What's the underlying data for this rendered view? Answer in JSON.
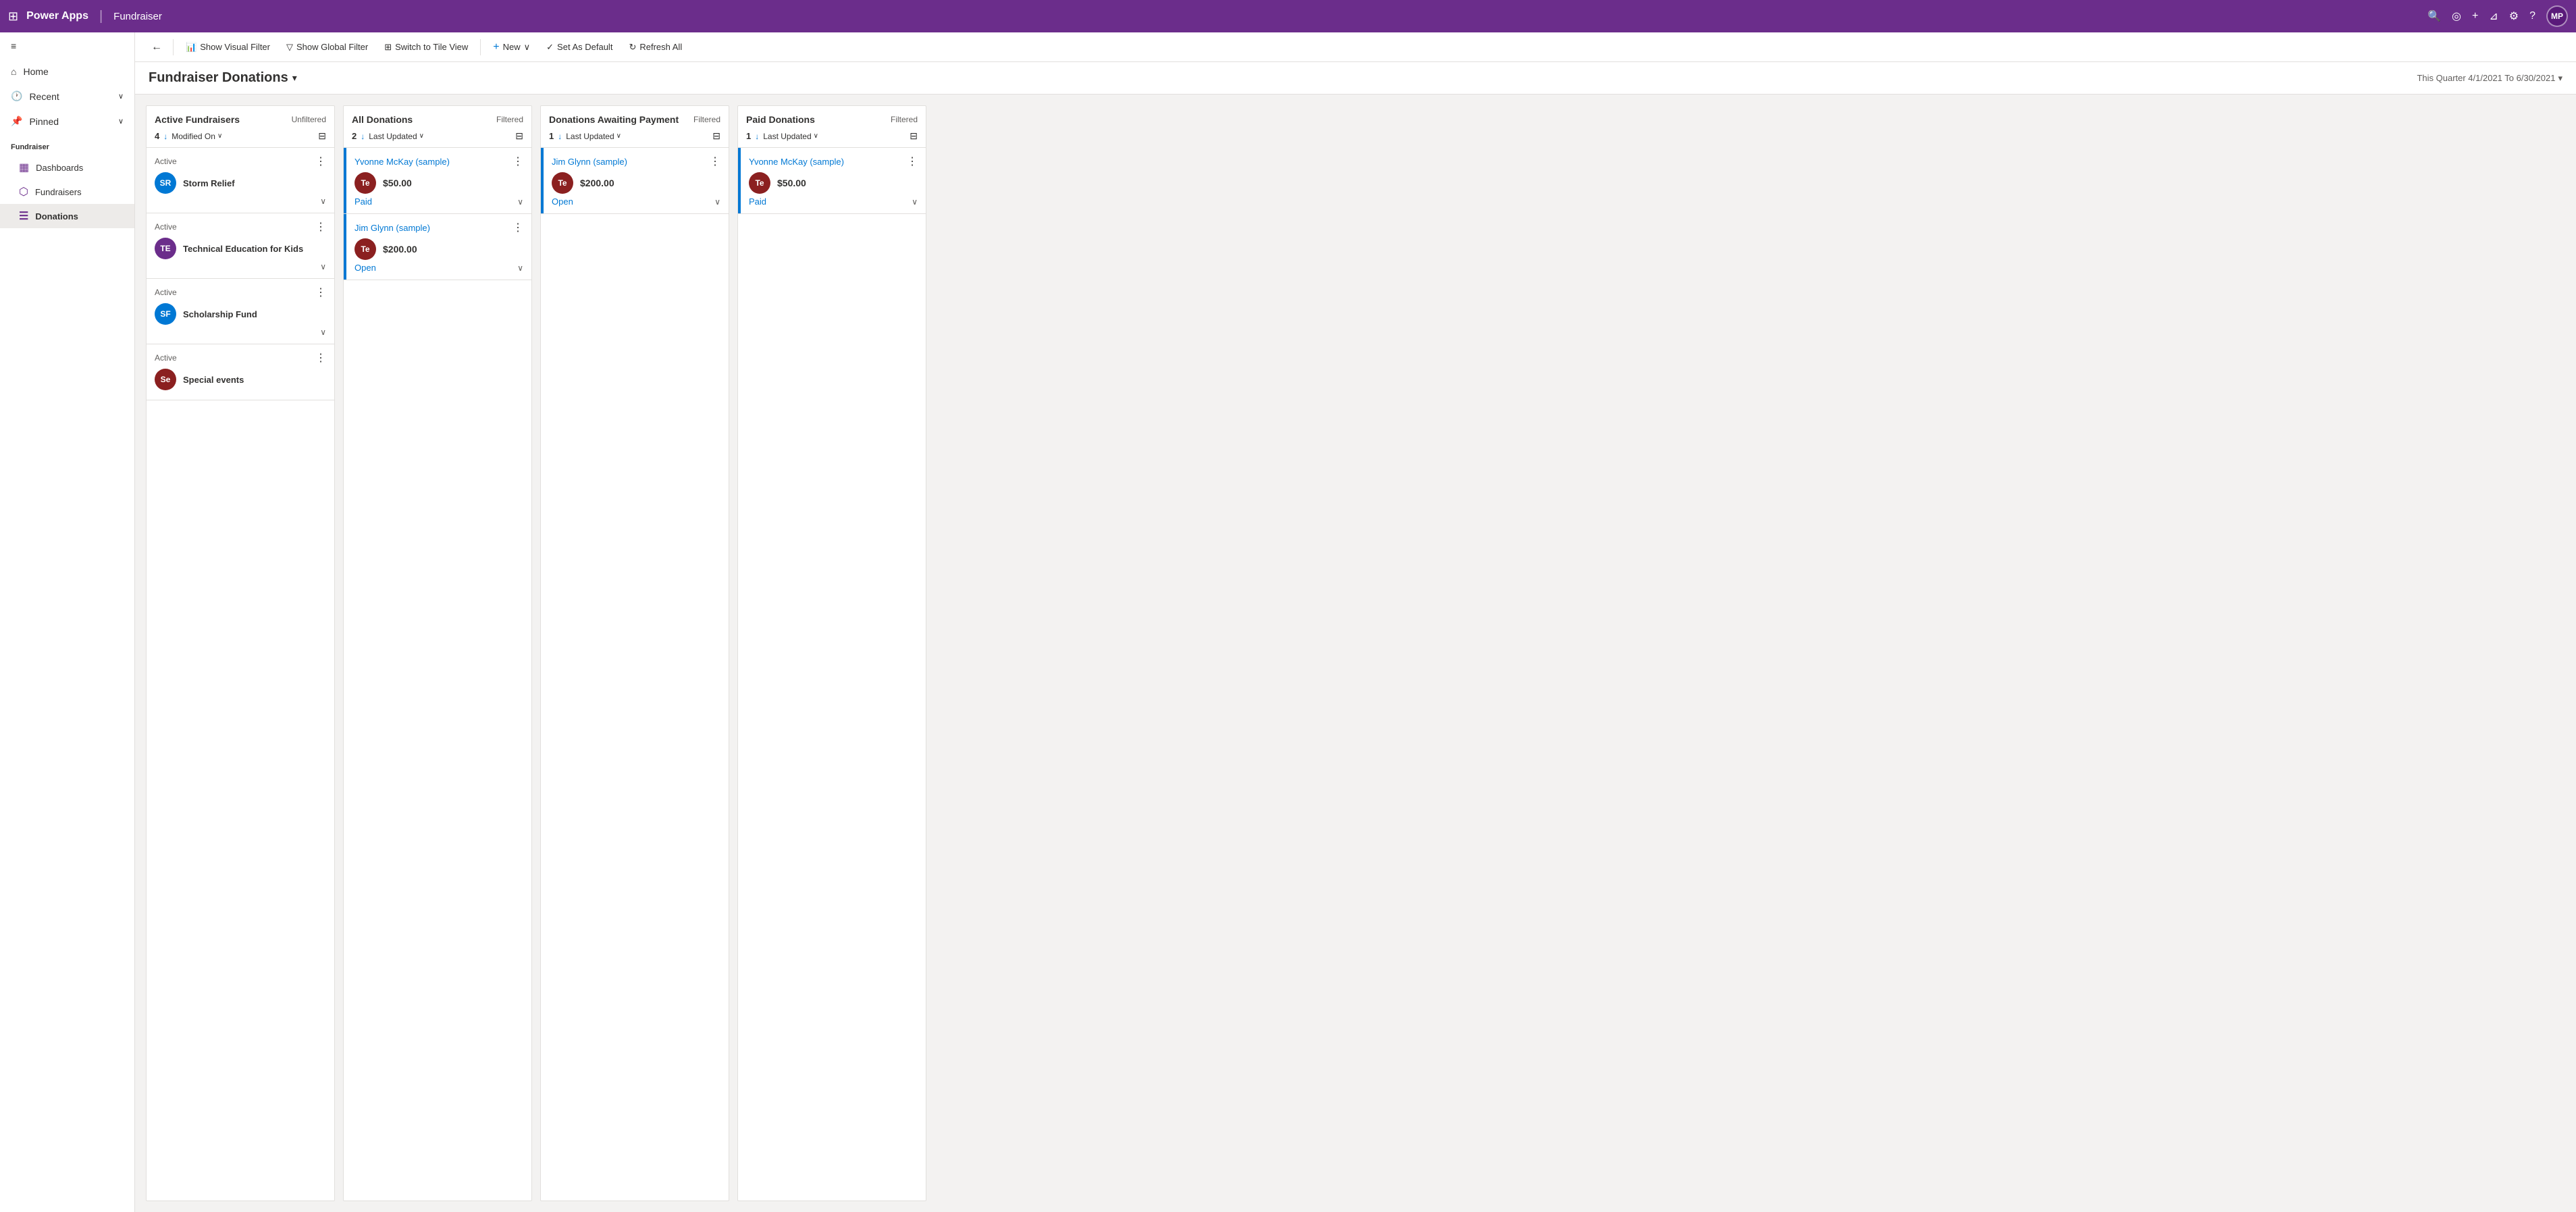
{
  "topNav": {
    "brand": "Power Apps",
    "appName": "Fundraiser",
    "separator": "|",
    "icons": [
      "search",
      "circle-checkmark",
      "plus",
      "filter",
      "settings",
      "help"
    ],
    "avatar": "MP"
  },
  "sidebar": {
    "toggle_icon": "≡",
    "nav_items": [
      {
        "label": "Home",
        "icon": "⌂"
      },
      {
        "label": "Recent",
        "icon": "🕐",
        "has_chevron": true
      },
      {
        "label": "Pinned",
        "icon": "📌",
        "has_chevron": true
      }
    ],
    "section_label": "Fundraiser",
    "sub_items": [
      {
        "label": "Dashboards",
        "icon": "▦"
      },
      {
        "label": "Fundraisers",
        "icon": "💰"
      },
      {
        "label": "Donations",
        "icon": "🗒",
        "active": true
      }
    ]
  },
  "commandBar": {
    "back_arrow": "←",
    "buttons": [
      {
        "id": "show-visual-filter",
        "icon": "📊",
        "label": "Show Visual Filter"
      },
      {
        "id": "show-global-filter",
        "icon": "▽",
        "label": "Show Global Filter"
      },
      {
        "id": "switch-tile-view",
        "icon": "⊞",
        "label": "Switch to Tile View"
      },
      {
        "id": "new",
        "icon": "+",
        "label": "New",
        "has_chevron": true
      },
      {
        "id": "set-default",
        "icon": "✓",
        "label": "Set As Default"
      },
      {
        "id": "refresh-all",
        "icon": "↻",
        "label": "Refresh All"
      }
    ]
  },
  "pageHeader": {
    "title": "Fundraiser Donations",
    "chevron": "▾",
    "dateFilter": "This Quarter 4/1/2021 To 6/30/2021",
    "dateChevron": "▾"
  },
  "kanban": {
    "columns": [
      {
        "id": "active-fundraisers",
        "title": "Active Fundraisers",
        "filterLabel": "Unfiltered",
        "count": 4,
        "sortField": "Modified On",
        "cards": [
          {
            "status": "Active",
            "name": "Storm Relief",
            "avatarBg": "#0078d4",
            "avatarText": "SR"
          },
          {
            "status": "Active",
            "name": "Technical Education for Kids",
            "avatarBg": "#6b2d8b",
            "avatarText": "TE"
          },
          {
            "status": "Active",
            "name": "Scholarship Fund",
            "avatarBg": "#0078d4",
            "avatarText": "SF"
          },
          {
            "status": "Active",
            "name": "Special events",
            "avatarBg": "#8b2020",
            "avatarText": "Se"
          }
        ]
      },
      {
        "id": "all-donations",
        "title": "All Donations",
        "filterLabel": "Filtered",
        "count": 2,
        "sortField": "Last Updated",
        "cards": [
          {
            "contactName": "Yvonne McKay (sample)",
            "avatarBg": "#8b2020",
            "avatarText": "Te",
            "amount": "$50.00",
            "status": "Paid",
            "statusType": "paid"
          },
          {
            "contactName": "Jim Glynn (sample)",
            "avatarBg": "#8b2020",
            "avatarText": "Te",
            "amount": "$200.00",
            "status": "Open",
            "statusType": "open"
          }
        ]
      },
      {
        "id": "awaiting-payment",
        "title": "Donations Awaiting Payment",
        "filterLabel": "Filtered",
        "count": 1,
        "sortField": "Last Updated",
        "cards": [
          {
            "contactName": "Jim Glynn (sample)",
            "avatarBg": "#8b2020",
            "avatarText": "Te",
            "amount": "$200.00",
            "status": "Open",
            "statusType": "open"
          }
        ]
      },
      {
        "id": "paid-donations",
        "title": "Paid Donations",
        "filterLabel": "Filtered",
        "count": 1,
        "sortField": "Last Updated",
        "cards": [
          {
            "contactName": "Yvonne McKay (sample)",
            "avatarBg": "#8b2020",
            "avatarText": "Te",
            "amount": "$50.00",
            "status": "Paid",
            "statusType": "paid"
          }
        ]
      }
    ]
  }
}
